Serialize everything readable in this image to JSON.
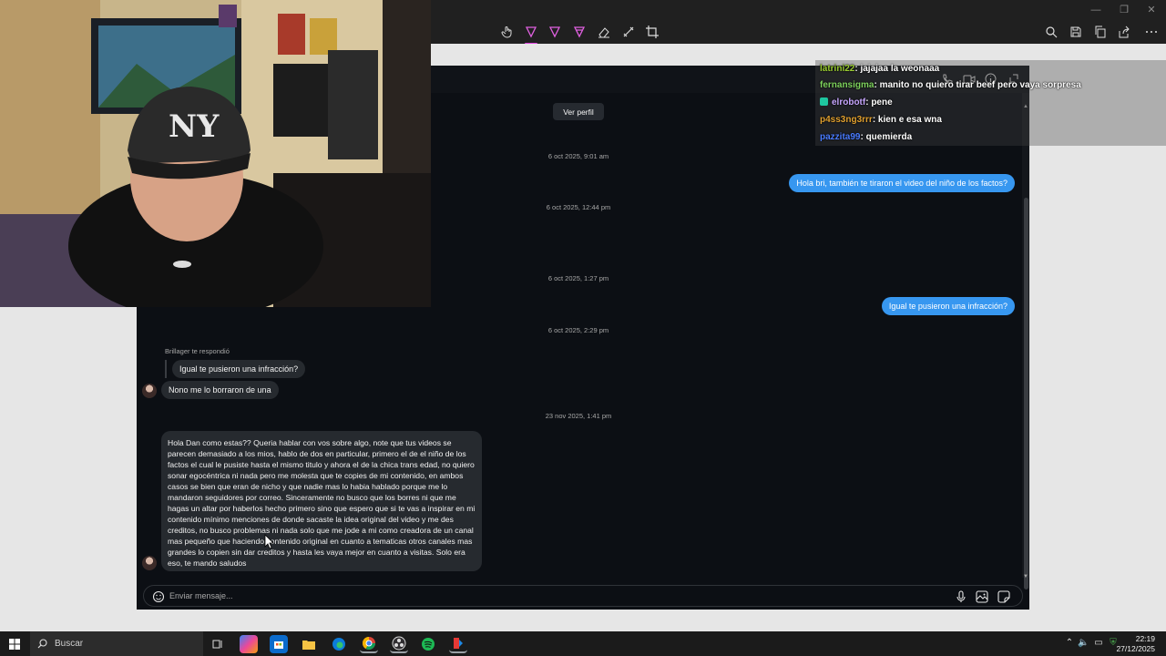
{
  "editor": {
    "window_controls": [
      "—",
      "❐",
      "✕"
    ]
  },
  "dm": {
    "ver_perfil": "Ver perfil",
    "timestamps": [
      "6 oct 2025, 9:01 am",
      "6 oct 2025, 12:44 pm",
      "6 oct 2025, 1:27 pm",
      "6 oct 2025, 2:29 pm",
      "23 nov 2025, 1:41 pm"
    ],
    "outgoing": [
      "Hola bri, también te tiraron el video del niño de los factos?",
      "Igual te pusieron una infracción?"
    ],
    "reply_label": "Brillager te respondió",
    "reply_quote": "Igual te pusieron una infracción?",
    "reply_text": "Nono me lo borraron de una",
    "long_message": "Hola Dan como estas?? Queria hablar con vos sobre algo, note que tus videos se parecen demasiado a los mios, hablo de dos en particular, primero el de el niño de los factos el cual le pusiste hasta el mismo titulo y ahora el de la chica trans edad, no quiero sonar egocéntrica ni nada pero me molesta que te copies de mi contenido, en ambos casos se bien que eran de nicho y que nadie mas lo habia hablado porque me lo mandaron seguidores por correo. Sinceramente no busco que los borres ni que me hagas un altar por haberlos hecho primero sino que espero que si te vas a inspirar en mi contenido mínimo menciones de donde sacaste la idea original del video y me des creditos, no busco problemas ni nada solo que me jode a mi como creadora de un canal mas pequeño que haciendo contenido original en cuanto a tematicas otros canales mas grandes lo copien sin dar creditos y hasta les vaya mejor en cuanto a visitas. Solo era eso, te mando saludos",
    "composer_placeholder": "Enviar mensaje..."
  },
  "chat": [
    {
      "user": "latrini22",
      "color": "#9acd32",
      "text": ": jajajaa la weonaaa",
      "badge": false
    },
    {
      "user": "fernansigma",
      "color": "#7fd35e",
      "text": ": manito no quiero tirar beef pero vaya sorpresa",
      "badge": false
    },
    {
      "user": "elrobotf",
      "color": "#c7a7ff",
      "text": ": pene",
      "badge": true
    },
    {
      "user": "p4ss3ng3rrr",
      "color": "#e0a030",
      "text": ": kien e esa wna",
      "badge": false
    },
    {
      "user": "pazzita99",
      "color": "#3a6cf0",
      "text": ": quemierda",
      "badge": false
    }
  ],
  "taskbar": {
    "search_label": "Buscar",
    "time": "22:19",
    "date": "27/12/2025"
  },
  "colors": {
    "accent_blue": "#3797f0",
    "dm_background": "#0c0f14",
    "incoming_bubble": "#262a2f",
    "active_tool": "#e040e0"
  }
}
